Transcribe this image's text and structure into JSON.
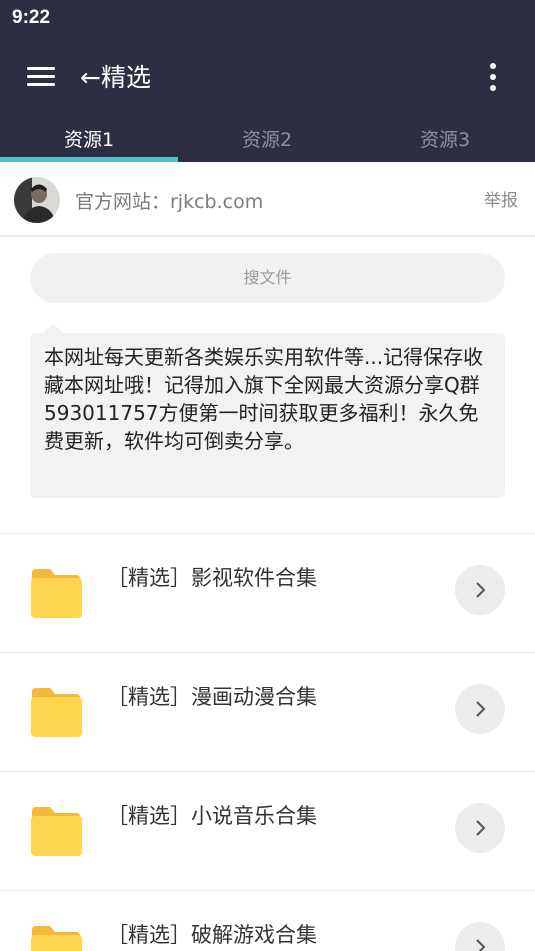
{
  "status_bar": {
    "time": "9:22"
  },
  "header": {
    "title": "←精选"
  },
  "tabs": [
    {
      "label": "资源1",
      "active": true
    },
    {
      "label": "资源2",
      "active": false
    },
    {
      "label": "资源3",
      "active": false
    }
  ],
  "site": {
    "label": "官方网站：rjkcb.com",
    "report": "举报"
  },
  "search": {
    "placeholder": "搜文件"
  },
  "notice": {
    "text": "本网址每天更新各类娱乐实用软件等...记得保存收藏本网址哦！记得加入旗下全网最大资源分享Q群593011757方便第一时间获取更多福利！永久免费更新，软件均可倒卖分享。"
  },
  "list": {
    "items": [
      {
        "label": "［精选］影视软件合集"
      },
      {
        "label": "［精选］漫画动漫合集"
      },
      {
        "label": "［精选］小说音乐合集"
      },
      {
        "label": "［精选］破解游戏合集"
      }
    ]
  },
  "colors": {
    "header_bg": "#2d2e45",
    "tab_indicator": "#4fc3c9",
    "folder": "#ffd54f"
  },
  "icons": {
    "menu": "hamburger-menu-icon",
    "more": "more-vertical-icon",
    "folder": "folder-icon",
    "chevron": "chevron-right-icon"
  }
}
